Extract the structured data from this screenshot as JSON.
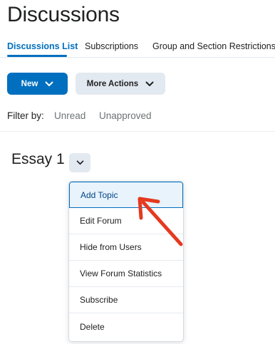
{
  "page": {
    "title": "Discussions"
  },
  "tabs": [
    {
      "label": "Discussions List",
      "active": true
    },
    {
      "label": "Subscriptions",
      "active": false
    },
    {
      "label": "Group and Section Restrictions",
      "active": false
    }
  ],
  "toolbar": {
    "new_label": "New",
    "more_actions_label": "More Actions"
  },
  "filter": {
    "label": "Filter by:",
    "options": [
      "Unread",
      "Unapproved"
    ]
  },
  "forum": {
    "title": "Essay 1"
  },
  "context_menu": {
    "items": [
      "Add Topic",
      "Edit Forum",
      "Hide from Users",
      "View Forum Statistics",
      "Subscribe",
      "Delete"
    ],
    "highlighted": "Add Topic"
  },
  "annotation": {
    "arrow_color": "#e5391f",
    "points_to": "Add Topic"
  },
  "colors": {
    "accent": "#006fbf",
    "secondary_button": "#e3e9f1",
    "muted_text": "#6e7376"
  }
}
